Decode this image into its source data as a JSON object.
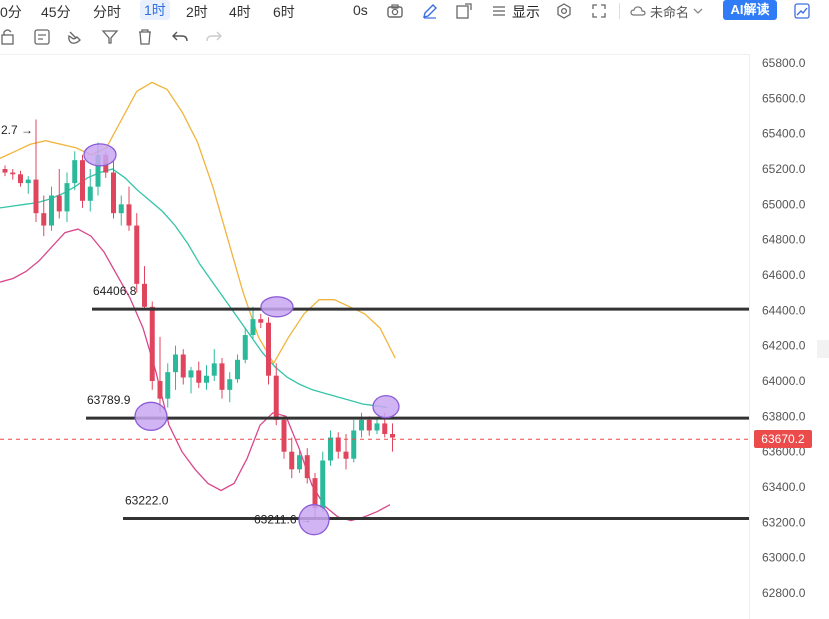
{
  "toolbar": {
    "timeframes": [
      "0分",
      "45分",
      "分时",
      "1时",
      "2时",
      "4时",
      "6时"
    ],
    "active_timeframe": "1时",
    "seconds_label": "0s",
    "display_label": "显示",
    "layout_name": "未命名",
    "ai_button": "AI解读",
    "icons": [
      "camera-icon",
      "pen-icon",
      "share-box-icon",
      "list-icon",
      "settings-icon",
      "fullscreen-icon",
      "cloud-icon",
      "chevron-down-icon",
      "trend-icon"
    ]
  },
  "drawing_tools": [
    "lock-icon",
    "template-icon",
    "magnet-icon",
    "filter-icon",
    "trash-icon",
    "undo-icon",
    "redo-icon"
  ],
  "chart_data": {
    "type": "candlestick",
    "ylim": [
      62700,
      65900
    ],
    "yticks": [
      62800.0,
      63000.0,
      63200.0,
      63400.0,
      63600.0,
      63800.0,
      64000.0,
      64200.0,
      64400.0,
      64600.0,
      64800.0,
      65000.0,
      65200.0,
      65400.0,
      65600.0,
      65800.0
    ],
    "ytick_labels": [
      "62800.0",
      "63000.0",
      "63200.0",
      "63400.0",
      "63600.0",
      "63800.0",
      "64000.0",
      "64200.0",
      "64400.0",
      "64600.0",
      "64800.0",
      "65000.0",
      "65200.0",
      "65400.0",
      "65600.0",
      "65800.0"
    ],
    "current_price": 63670.2,
    "current_price_label": "63670.2",
    "candles": [
      [
        65200,
        65220,
        65160,
        65180
      ],
      [
        65180,
        65200,
        65140,
        65170
      ],
      [
        65170,
        65190,
        65100,
        65120
      ],
      [
        65120,
        65160,
        65060,
        65140
      ],
      [
        65140,
        65480,
        64900,
        64950
      ],
      [
        64950,
        65050,
        64820,
        64880
      ],
      [
        64880,
        65100,
        64850,
        65050
      ],
      [
        65050,
        65200,
        64920,
        64960
      ],
      [
        64960,
        65180,
        64900,
        65120
      ],
      [
        65120,
        65300,
        65080,
        65250
      ],
      [
        65250,
        65280,
        64980,
        65020
      ],
      [
        65020,
        65200,
        64960,
        65100
      ],
      [
        65100,
        65350,
        65050,
        65280
      ],
      [
        65280,
        65300,
        65150,
        65180
      ],
      [
        65180,
        65250,
        64920,
        64950
      ],
      [
        64950,
        65050,
        64880,
        65000
      ],
      [
        65000,
        65100,
        64850,
        64880
      ],
      [
        64880,
        64950,
        64500,
        64550
      ],
      [
        64550,
        64650,
        64400,
        64420
      ],
      [
        64420,
        64450,
        63950,
        64000
      ],
      [
        64000,
        64250,
        63820,
        63900
      ],
      [
        63900,
        64100,
        63850,
        64050
      ],
      [
        64050,
        64200,
        63950,
        64150
      ],
      [
        64150,
        64180,
        63980,
        64020
      ],
      [
        64020,
        64080,
        63930,
        64060
      ],
      [
        64060,
        64110,
        63960,
        63990
      ],
      [
        63990,
        64090,
        63950,
        64030
      ],
      [
        64030,
        64180,
        64000,
        64100
      ],
      [
        64100,
        64130,
        63900,
        63950
      ],
      [
        63950,
        64050,
        63880,
        64010
      ],
      [
        64010,
        64150,
        63990,
        64120
      ],
      [
        64120,
        64300,
        64100,
        64260
      ],
      [
        64260,
        64420,
        64240,
        64350
      ],
      [
        64350,
        64380,
        64300,
        64330
      ],
      [
        64330,
        64360,
        63980,
        64030
      ],
      [
        64030,
        64100,
        63750,
        63780
      ],
      [
        63780,
        63800,
        63560,
        63600
      ],
      [
        63600,
        63680,
        63450,
        63500
      ],
      [
        63500,
        63620,
        63480,
        63580
      ],
      [
        63580,
        63620,
        63420,
        63450
      ],
      [
        63450,
        63480,
        63211,
        63280
      ],
      [
        63280,
        63600,
        63260,
        63550
      ],
      [
        63550,
        63720,
        63520,
        63680
      ],
      [
        63680,
        63710,
        63560,
        63600
      ],
      [
        63600,
        63700,
        63500,
        63560
      ],
      [
        63560,
        63780,
        63540,
        63720
      ],
      [
        63720,
        63820,
        63680,
        63780
      ],
      [
        63780,
        63800,
        63690,
        63720
      ],
      [
        63720,
        63790,
        63700,
        63760
      ],
      [
        63760,
        63820,
        63680,
        63700
      ],
      [
        63700,
        63760,
        63600,
        63680
      ]
    ],
    "ma_mid": [
      64980,
      64990,
      65000,
      65010,
      65030,
      65060,
      65100,
      65150,
      65180,
      65200,
      65150,
      65080,
      65020,
      64960,
      64880,
      64780,
      64660,
      64560,
      64460,
      64360,
      64260,
      64160,
      64080,
      64020,
      63980,
      63950,
      63930,
      63910,
      63890,
      63870,
      63860,
      63850
    ],
    "upper_band": [
      65260,
      65300,
      65340,
      65360,
      65340,
      65320,
      65280,
      65320,
      65480,
      65640,
      65690,
      65650,
      65520,
      65350,
      65100,
      64800,
      64500,
      64250,
      64100,
      64250,
      64380,
      64460,
      64460,
      64420,
      64380,
      64300,
      64130
    ],
    "lower_band": [
      64560,
      64580,
      64620,
      64680,
      64760,
      64840,
      64860,
      64820,
      64730,
      64600,
      64470,
      64300,
      64050,
      63750,
      63600,
      63500,
      63420,
      63380,
      63420,
      63560,
      63750,
      63820,
      63800,
      63620,
      63410,
      63290,
      63230,
      63210,
      63230,
      63260,
      63300
    ],
    "levels": [
      {
        "price": 64406.8,
        "label": "64406.8"
      },
      {
        "price": 63789.9,
        "label": "63789.9"
      },
      {
        "price": 63222.0,
        "label": "63222.0"
      }
    ],
    "annotations": [
      {
        "text": "2.7",
        "price": 65420
      },
      {
        "text": "63211.6",
        "price": 63215
      }
    ]
  },
  "colors": {
    "up": "#2ab99a",
    "down": "#e0455e",
    "upper_band": "#f0b43c",
    "mid_band": "#33c4a8",
    "lower_band": "#d8478c",
    "level_line": "#333333",
    "marker_fill": "#c8a7f2",
    "marker_stroke": "#8b5cd6",
    "price_tag": "#ec4b4b",
    "accent": "#2f7cf6"
  }
}
